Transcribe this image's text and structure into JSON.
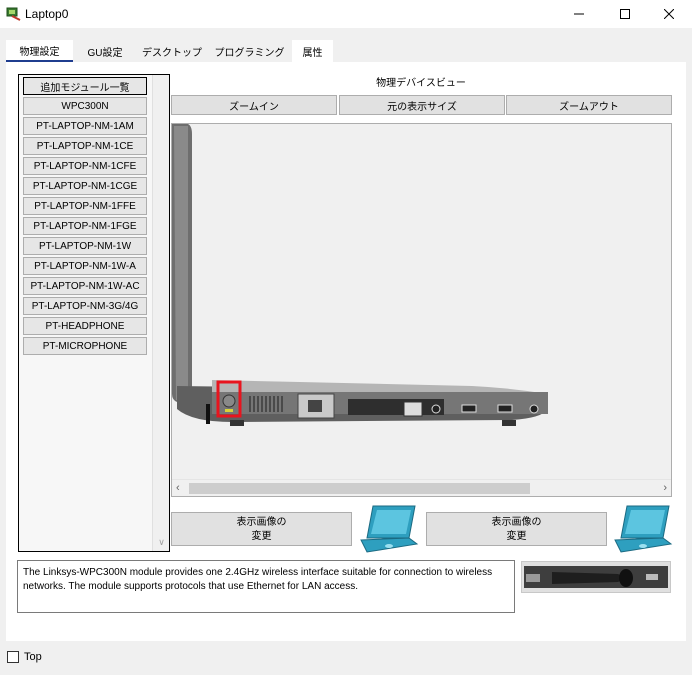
{
  "window": {
    "title": "Laptop0"
  },
  "tabs": [
    {
      "label": "物理設定"
    },
    {
      "label": "GU設定"
    },
    {
      "label": "デスクトップ"
    },
    {
      "label": "プログラミング"
    },
    {
      "label": "属性"
    }
  ],
  "module_list": {
    "items": [
      {
        "label": "追加モジュール一覧"
      },
      {
        "label": "WPC300N"
      },
      {
        "label": "PT-LAPTOP-NM-1AM"
      },
      {
        "label": "PT-LAPTOP-NM-1CE"
      },
      {
        "label": "PT-LAPTOP-NM-1CFE"
      },
      {
        "label": "PT-LAPTOP-NM-1CGE"
      },
      {
        "label": "PT-LAPTOP-NM-1FFE"
      },
      {
        "label": "PT-LAPTOP-NM-1FGE"
      },
      {
        "label": "PT-LAPTOP-NM-1W"
      },
      {
        "label": "PT-LAPTOP-NM-1W-A"
      },
      {
        "label": "PT-LAPTOP-NM-1W-AC"
      },
      {
        "label": "PT-LAPTOP-NM-3G/4G"
      },
      {
        "label": "PT-HEADPHONE"
      },
      {
        "label": "PT-MICROPHONE"
      }
    ]
  },
  "physical_view": {
    "title": "物理デバイスビュー",
    "zoom_in": "ズームイン",
    "original_size": "元の表示サイズ",
    "zoom_out": "ズームアウト"
  },
  "change_image": {
    "line1": "表示画像の",
    "line2": "変更"
  },
  "description": "The Linksys-WPC300N module provides one 2.4GHz wireless interface suitable for connection to wireless networks. The module supports protocols that use Ethernet for LAN access.",
  "footer": {
    "top_label": "Top"
  },
  "colors": {
    "tab_active_underline": "#1f3d8f",
    "highlight_red": "#e8141e",
    "laptop_teal": "#2e9fbf"
  }
}
